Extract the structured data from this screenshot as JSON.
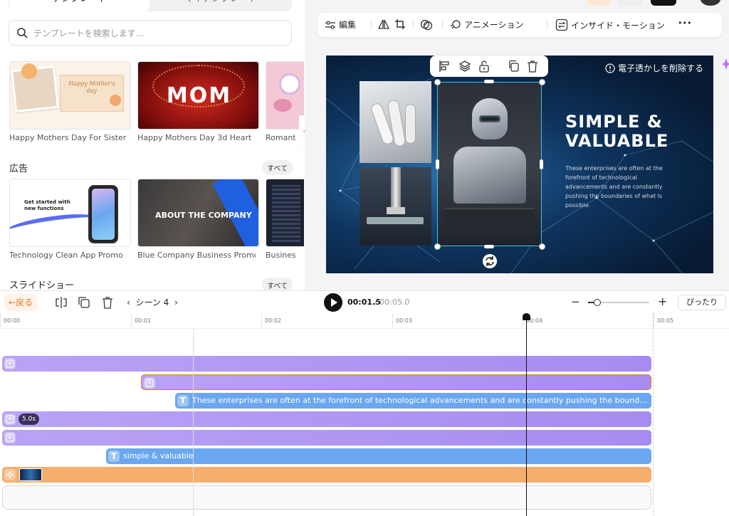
{
  "left_panel": {
    "tabs": [
      "テンプレート",
      "マイテンプレート"
    ],
    "search_placeholder": "テンプレートを検索します...",
    "row1": [
      {
        "caption": "Happy Mothers Day For Sister",
        "art": "Happy Mother's day"
      },
      {
        "caption": "Happy Mothers Day 3d Heart",
        "art": "MOM"
      },
      {
        "caption": "Romanti",
        "art": ""
      }
    ],
    "section_ads": {
      "title": "広告",
      "see_all": "すべて"
    },
    "row2": [
      {
        "caption": "Technology Clean App Promo",
        "art": "Get started with new functions"
      },
      {
        "caption": "Blue Company Business Promo ...",
        "art": "ABOUT THE COMPANY"
      },
      {
        "caption": "Busines",
        "art": ""
      }
    ],
    "section_slides": {
      "title": "スライドショー",
      "see_all": "すべて"
    }
  },
  "toolbar": {
    "edit": "編集",
    "animation": "アニメーション",
    "inside_motion": "インサイド・モーション",
    "more": "•••"
  },
  "canvas": {
    "watermark": "電子透かしを削除する",
    "title_line1": "SIMPLE &",
    "title_line2": "VALUABLE",
    "body": "These enterprises are often at the forefront of technological advancements and are constantly pushing the boundaries of what is possible."
  },
  "timeline": {
    "back": "←戻る",
    "scene": "シーン 4",
    "time_current": "00:01.5",
    "time_total": "/ 00:05.0",
    "fit": "ぴったり",
    "zoom_level": 0.15,
    "ruler": [
      "00:00",
      "00:01",
      "00:02",
      "00:03",
      "00:04",
      "00:05"
    ],
    "tracks": {
      "text_body": "These enterprises are often at  the forefront of technological  advancements and are constantly  pushing the boundaries of what is possible.",
      "duration_badge": "5.0s",
      "text_title": "simple &  valuable"
    }
  },
  "colors": {
    "accent_orange": "#e8772b",
    "track_purple": "#a68cf0",
    "track_blue": "#6aa7f0",
    "track_orange": "#f5ae6e",
    "selection": "#3ec1e6"
  }
}
